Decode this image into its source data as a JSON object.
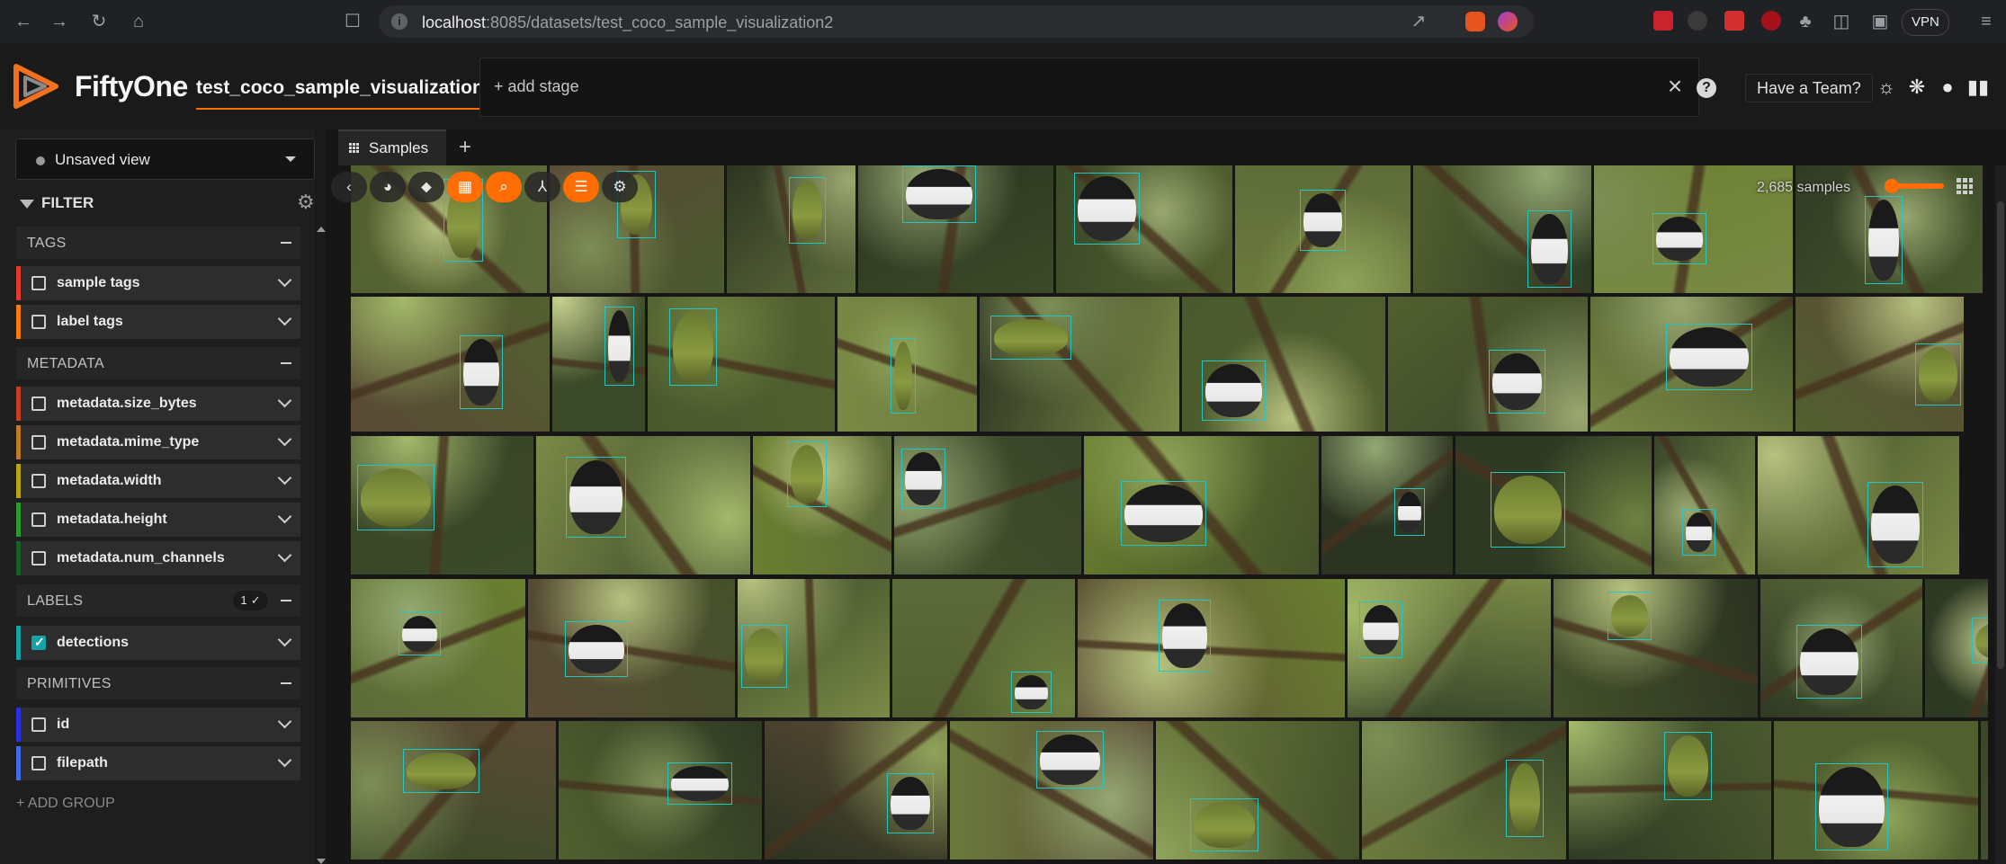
{
  "browser": {
    "url_host": "localhost",
    "url_path": ":8085/datasets/test_coco_sample_visualization2",
    "vpn_label": "VPN",
    "brave_badge": "1",
    "ext_badge": "1"
  },
  "header": {
    "brand": "FiftyOne",
    "dataset_name": "test_coco_sample_visualization2",
    "add_stage": "+ add stage",
    "team_button": "Have a Team?"
  },
  "sidebar": {
    "view_select": "Unsaved view",
    "filter_title": "FILTER",
    "groups": [
      {
        "label": "TAGS"
      },
      {
        "label": "METADATA"
      },
      {
        "label": "LABELS",
        "badge": "1 ✓"
      },
      {
        "label": "PRIMITIVES"
      }
    ],
    "fields": [
      {
        "label": "sample tags",
        "color": "#e23a2c",
        "checked": false
      },
      {
        "label": "label tags",
        "color": "#f57a12",
        "checked": false
      },
      {
        "label": "metadata.size_bytes",
        "color": "#c4401f",
        "checked": false
      },
      {
        "label": "metadata.mime_type",
        "color": "#c07a2b",
        "checked": false
      },
      {
        "label": "metadata.width",
        "color": "#b8a512",
        "checked": false
      },
      {
        "label": "metadata.height",
        "color": "#2a9a2a",
        "checked": false
      },
      {
        "label": "metadata.num_channels",
        "color": "#1a5e2a",
        "checked": false
      },
      {
        "label": "detections",
        "color": "#17a2a5",
        "checked": true
      },
      {
        "label": "id",
        "color": "#2a2fe0",
        "checked": false
      },
      {
        "label": "filepath",
        "color": "#3e6fe5",
        "checked": false
      }
    ],
    "add_group": "+ ADD GROUP"
  },
  "main": {
    "tab_label": "Samples",
    "sample_count": "2,685 samples",
    "toolbar": [
      {
        "name": "back-icon",
        "glyph": "‹",
        "active": false
      },
      {
        "name": "color-palette-icon",
        "glyph": "◕",
        "active": false
      },
      {
        "name": "tag-icon",
        "glyph": "⬥",
        "active": false
      },
      {
        "name": "patches-icon",
        "glyph": "▦",
        "active": true
      },
      {
        "name": "search-icon",
        "glyph": "⌕",
        "active": true
      },
      {
        "name": "merge-icon",
        "glyph": "⅄",
        "active": false
      },
      {
        "name": "list-icon",
        "glyph": "☰",
        "active": true
      },
      {
        "name": "settings-icon",
        "glyph": "⚙",
        "active": false
      }
    ]
  },
  "colors": {
    "accent": "#ff6d04",
    "detection_box": "#26c6c0"
  }
}
